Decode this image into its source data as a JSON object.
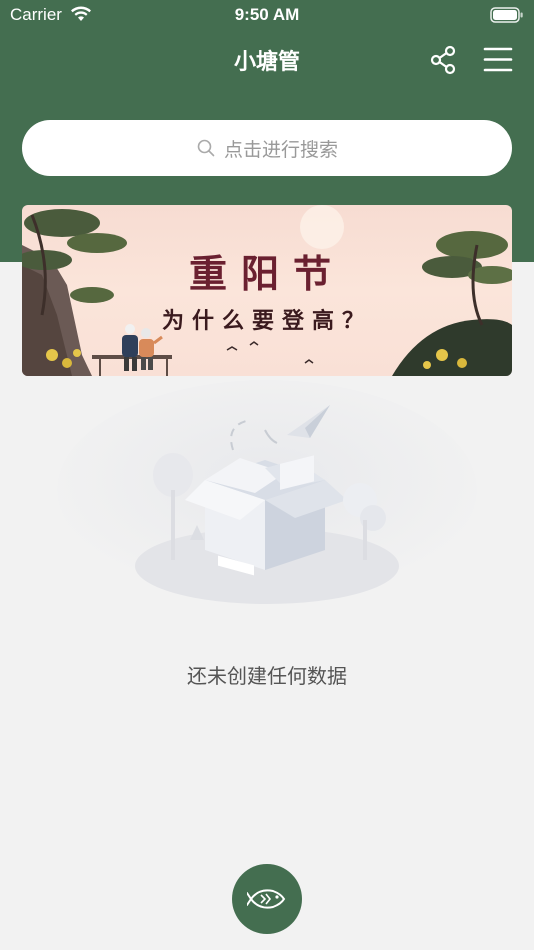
{
  "status_bar": {
    "carrier": "Carrier",
    "time": "9:50 AM"
  },
  "nav": {
    "title": "小塘管",
    "share_icon": "share-icon",
    "menu_icon": "menu-icon"
  },
  "search": {
    "placeholder": "点击进行搜索"
  },
  "banner": {
    "title": "重阳节",
    "subtitle": "为什么要登高？"
  },
  "empty_state": {
    "message": "还未创建任何数据"
  },
  "fab": {
    "icon": "fish-icon"
  },
  "colors": {
    "primary_green": "#446e50",
    "background": "#f2f2f2",
    "banner_title": "#6a2030"
  }
}
